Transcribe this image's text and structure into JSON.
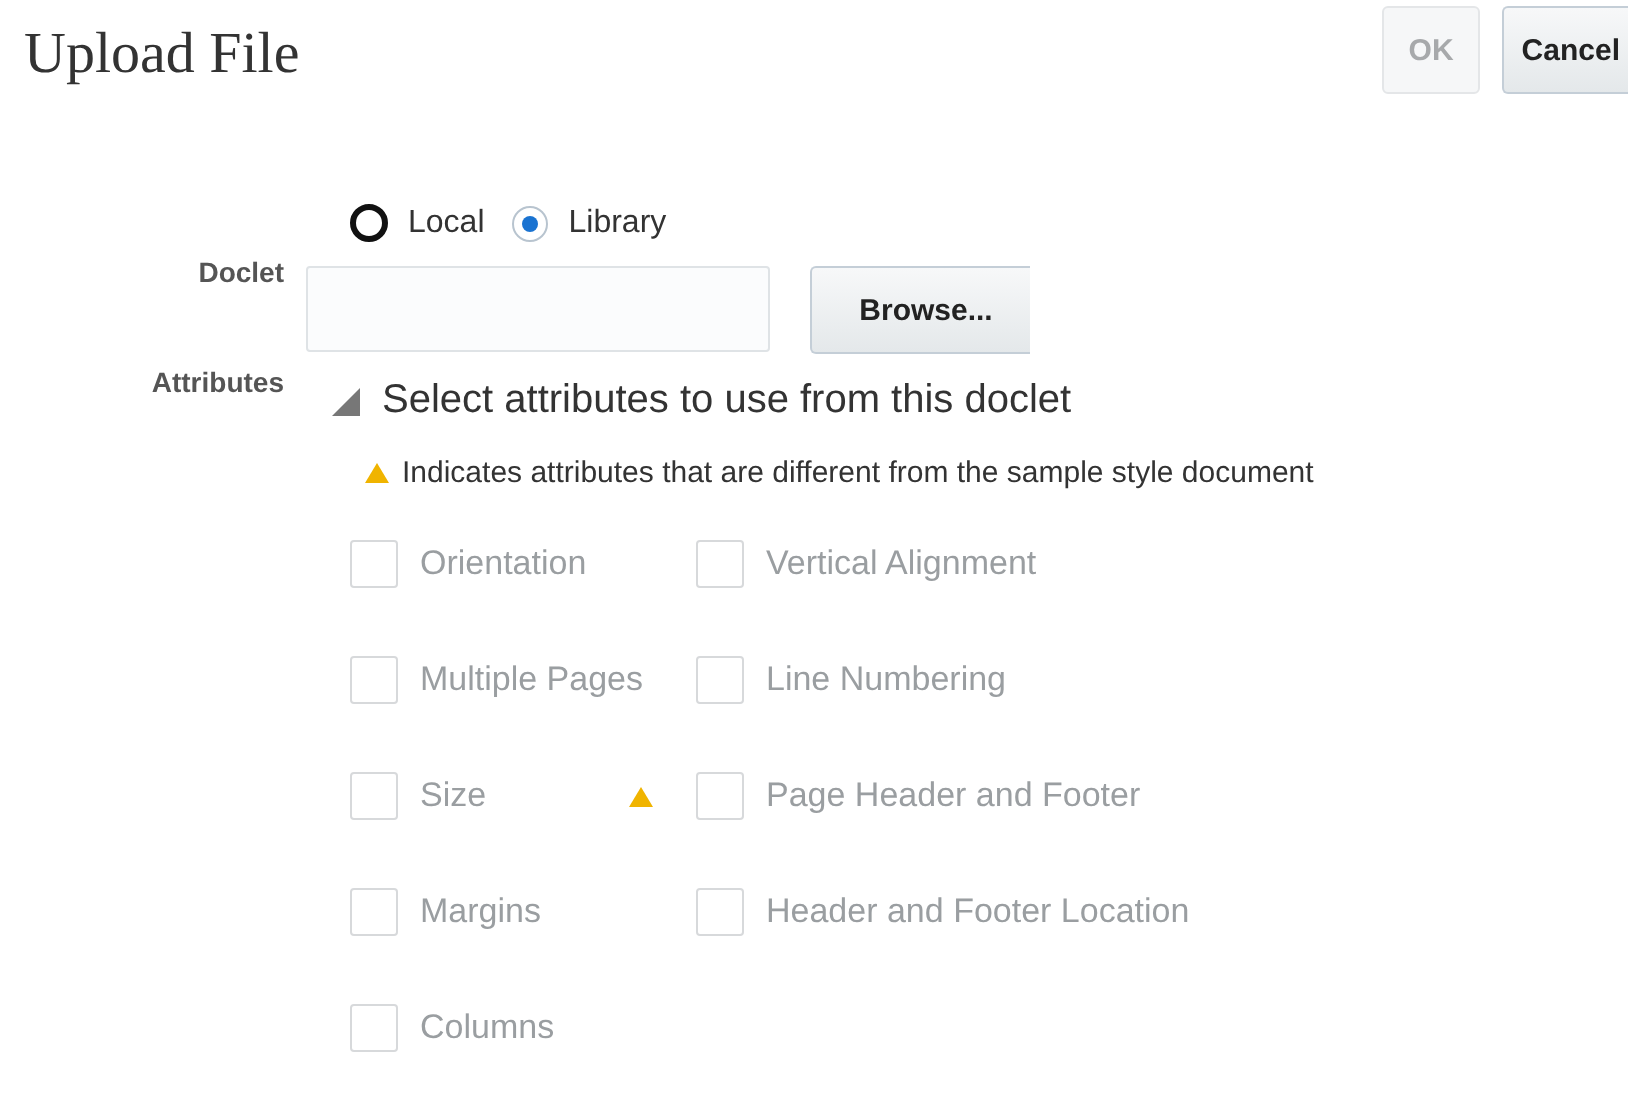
{
  "title": "Upload File",
  "buttons": [
    {
      "label": "OK",
      "disabled": true
    },
    {
      "label": "Cancel",
      "disabled": false
    }
  ],
  "doclet": {
    "label": "Doclet",
    "options": [
      {
        "label": "Local",
        "selected": false
      },
      {
        "label": "Library",
        "selected": true
      }
    ],
    "browse": "Browse..."
  },
  "attributes": {
    "label": "Attributes",
    "section": "Select attributes to use from this doclet",
    "expanded": true,
    "note": "Indicates attributes that are different from the sample style document",
    "left_column": [
      {
        "label": "Orientation",
        "checked": false,
        "disabled": true,
        "different": false
      },
      {
        "label": "Multiple Pages",
        "checked": false,
        "disabled": true,
        "different": false
      },
      {
        "label": "Size",
        "checked": false,
        "disabled": true,
        "different": false
      },
      {
        "label": "Margins",
        "checked": false,
        "disabled": true,
        "different": false
      },
      {
        "label": "Columns",
        "checked": false,
        "disabled": true,
        "different": false
      }
    ],
    "right_column": [
      {
        "label": "Vertical Alignment",
        "checked": false,
        "disabled": true,
        "different": false
      },
      {
        "label": "Line Numbering",
        "checked": false,
        "disabled": true,
        "different": false
      },
      {
        "label": "Page Header and Footer",
        "checked": false,
        "disabled": true,
        "different": true
      },
      {
        "label": "Header and Footer Location",
        "checked": false,
        "disabled": true,
        "different": false
      }
    ]
  }
}
